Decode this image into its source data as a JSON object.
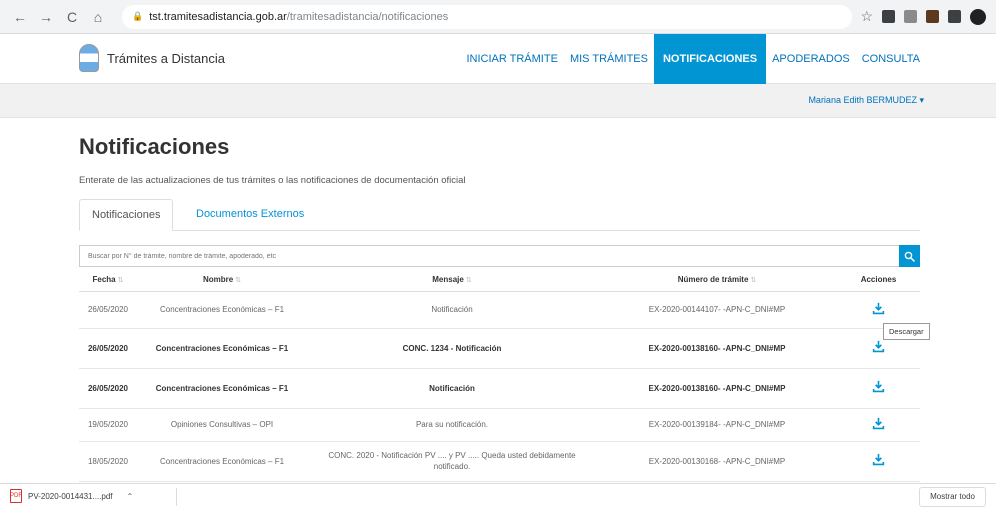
{
  "browser": {
    "url_host": "tst.tramitesadistancia.gob.ar",
    "url_path": "/tramitesadistancia/notificaciones"
  },
  "header": {
    "brand": "Trámites a Distancia",
    "nav": [
      {
        "label": "INICIAR TRÁMITE"
      },
      {
        "label": "MIS TRÁMITES"
      },
      {
        "label": "NOTIFICACIONES"
      },
      {
        "label": "APODERADOS"
      },
      {
        "label": "CONSULTA"
      }
    ],
    "active_nav": "NOTIFICACIONES"
  },
  "user": {
    "name": "Mariana Edith BERMUDEZ ▾"
  },
  "page": {
    "title": "Notificaciones",
    "subtitle": "Enterate de las actualizaciones de tus trámites o las notificaciones de documentación oficial",
    "tabs": [
      {
        "label": "Notificaciones"
      },
      {
        "label": "Documentos Externos"
      }
    ],
    "search_placeholder": "Buscar por N° de trámite, nombre de trámite, apoderado, etc"
  },
  "table": {
    "columns": [
      "Fecha",
      "Nombre",
      "Mensaje",
      "Número de trámite",
      "Acciones"
    ],
    "rows": [
      {
        "fecha": "26/05/2020",
        "nombre": "Concentraciones Económicas – F1",
        "mensaje": "Notificación",
        "numero": "EX-2020-00144107- -APN-C_DNI#MP",
        "unread": false
      },
      {
        "fecha": "26/05/2020",
        "nombre": "Concentraciones Económicas – F1",
        "mensaje": "CONC. 1234 - Notificación",
        "numero": "EX-2020-00138160- -APN-C_DNI#MP",
        "unread": true
      },
      {
        "fecha": "26/05/2020",
        "nombre": "Concentraciones Económicas – F1",
        "mensaje": "Notificación",
        "numero": "EX-2020-00138160- -APN-C_DNI#MP",
        "unread": true
      },
      {
        "fecha": "19/05/2020",
        "nombre": "Opiniones Consultivas – OPI",
        "mensaje": "Para su notificación.",
        "numero": "EX-2020-00139184- -APN-C_DNI#MP",
        "unread": false
      },
      {
        "fecha": "18/05/2020",
        "nombre": "Concentraciones Económicas – F1",
        "mensaje": "CONC. 2020 - Notificación PV .... y PV ..... Queda usted debidamente notificado.",
        "numero": "EX-2020-00130168- -APN-C_DNI#MP",
        "unread": false
      }
    ],
    "tooltip": "Descargar"
  },
  "downloads": {
    "file": "PV-2020-0014431....pdf",
    "show_all": "Mostrar todo"
  },
  "colors": {
    "primary": "#0295d4",
    "link": "#0072bb"
  }
}
